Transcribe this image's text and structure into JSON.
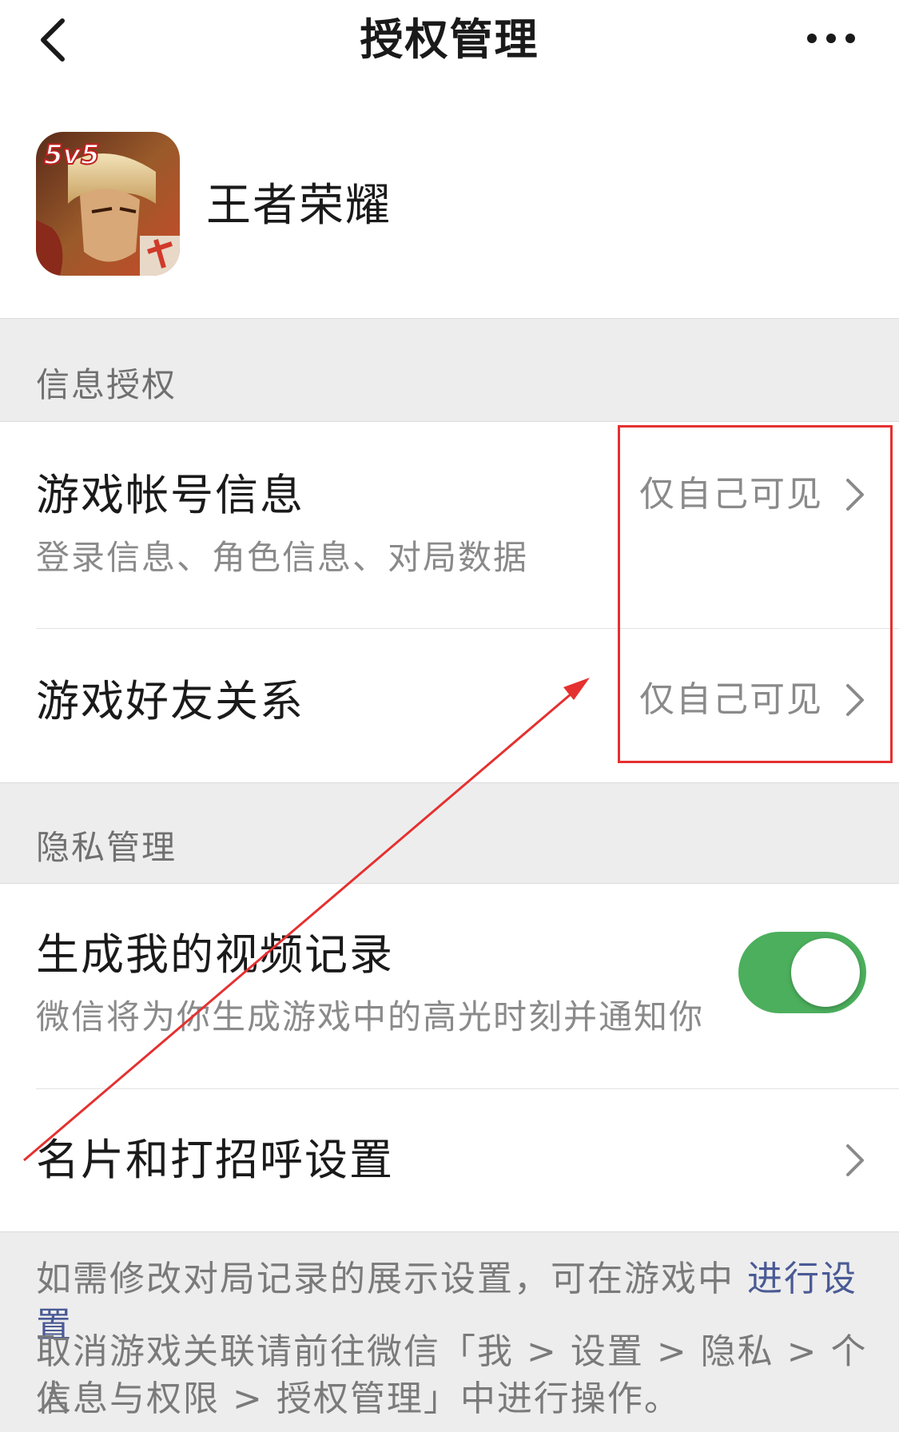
{
  "nav": {
    "title": "授权管理"
  },
  "app": {
    "name": "王者荣耀",
    "icon_badge": "5v5"
  },
  "info_auth": {
    "section_label": "信息授权",
    "items": [
      {
        "title": "游戏帐号信息",
        "subtitle": "登录信息、角色信息、对局数据",
        "value": "仅自己可见"
      },
      {
        "title": "游戏好友关系",
        "value": "仅自己可见"
      }
    ]
  },
  "privacy": {
    "section_label": "隐私管理",
    "video_record": {
      "title": "生成我的视频记录",
      "subtitle": "微信将为你生成游戏中的高光时刻并通知你",
      "enabled": true
    },
    "card_greeting": {
      "title": "名片和打招呼设置"
    }
  },
  "footer": {
    "line1_text": "如需修改对局记录的展示设置，可在游戏中 ",
    "line1_link": "进行设置",
    "line2": "取消游戏关联请前往微信「我 > 设置 > 隐私 > 个人",
    "line3": "信息与权限 > 授权管理」中进行操作。"
  },
  "colors": {
    "toggle_on": "#4caf5d",
    "link": "#4a5a95",
    "annotation": "#e53030"
  }
}
